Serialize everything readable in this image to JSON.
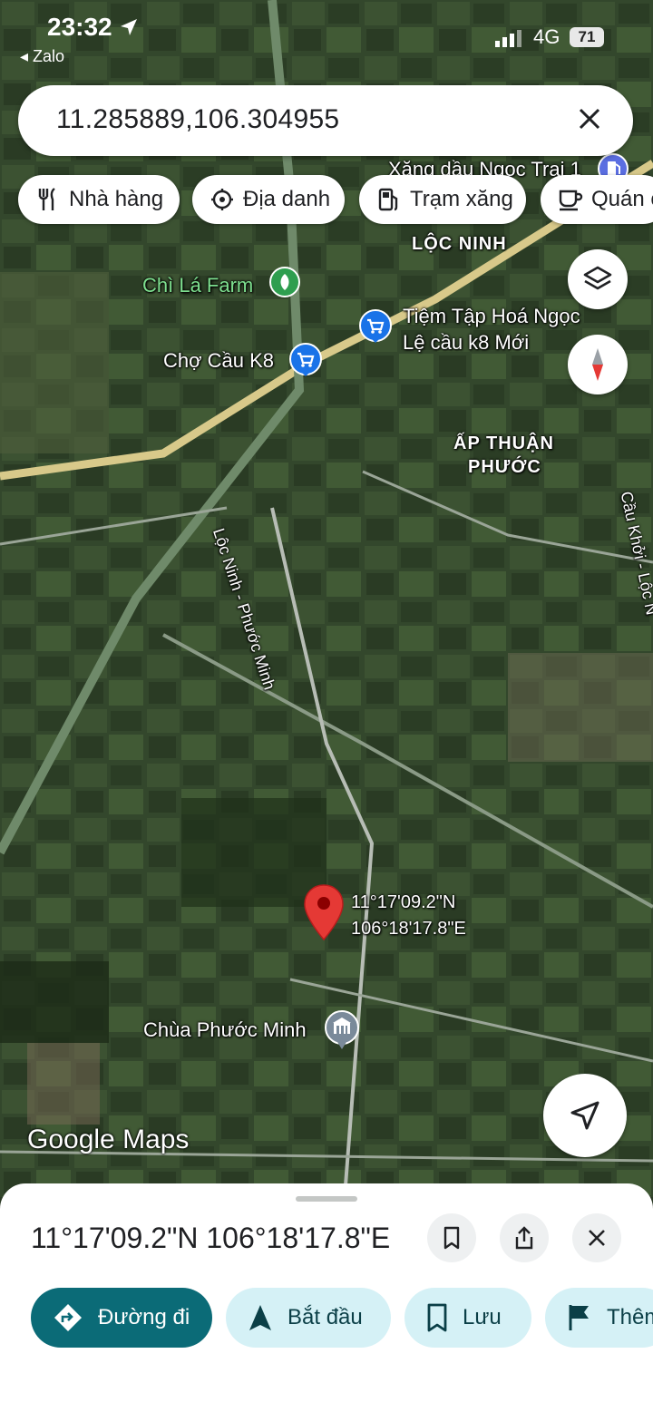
{
  "status_bar": {
    "time": "23:32",
    "back_app": "◂ Zalo",
    "network": "4G",
    "battery": "71"
  },
  "search": {
    "query": "11.285889,106.304955"
  },
  "chips": [
    {
      "label": "Nhà hàng",
      "icon": "fork-knife-icon"
    },
    {
      "label": "Địa danh",
      "icon": "landmark-icon"
    },
    {
      "label": "Trạm xăng",
      "icon": "gas-station-icon"
    },
    {
      "label": "Quán c",
      "icon": "coffee-icon"
    }
  ],
  "map": {
    "places": {
      "xang_dau": "Xăng dầu Ngọc Trai 1",
      "loc_ninh": "LỘC NINH",
      "chi_la_farm": "Chì Lá Farm",
      "tiem_tap_hoa_1": "Tiệm Tập Hoá Ngọc",
      "tiem_tap_hoa_2": "Lệ cầu k8 Mới",
      "cho_cau": "Chợ Cầu K8",
      "ap_thuan_1": "ẤP THUẬN",
      "ap_thuan_2": "PHƯỚC",
      "road_loc_ninh": "Lộc Ninh - Phước Minh",
      "road_cau_khoi": "Cầu Khởi - Lộc N",
      "chua": "Chùa Phước Minh"
    },
    "pin_lat": "11°17'09.2\"N",
    "pin_lng": "106°18'17.8\"E",
    "logo": "Google Maps"
  },
  "sheet": {
    "coordinates": "11°17'09.2\"N 106°18'17.8\"E",
    "actions": [
      {
        "label": "Đường đi"
      },
      {
        "label": "Bắt đầu"
      },
      {
        "label": "Lưu"
      },
      {
        "label": "Thêm"
      }
    ]
  },
  "colors": {
    "accent": "#0b6b77",
    "light_button": "#d5f1f6",
    "pin": "#e53935",
    "place_green": "#7ee08f",
    "shop_blue": "#1a73e8"
  }
}
